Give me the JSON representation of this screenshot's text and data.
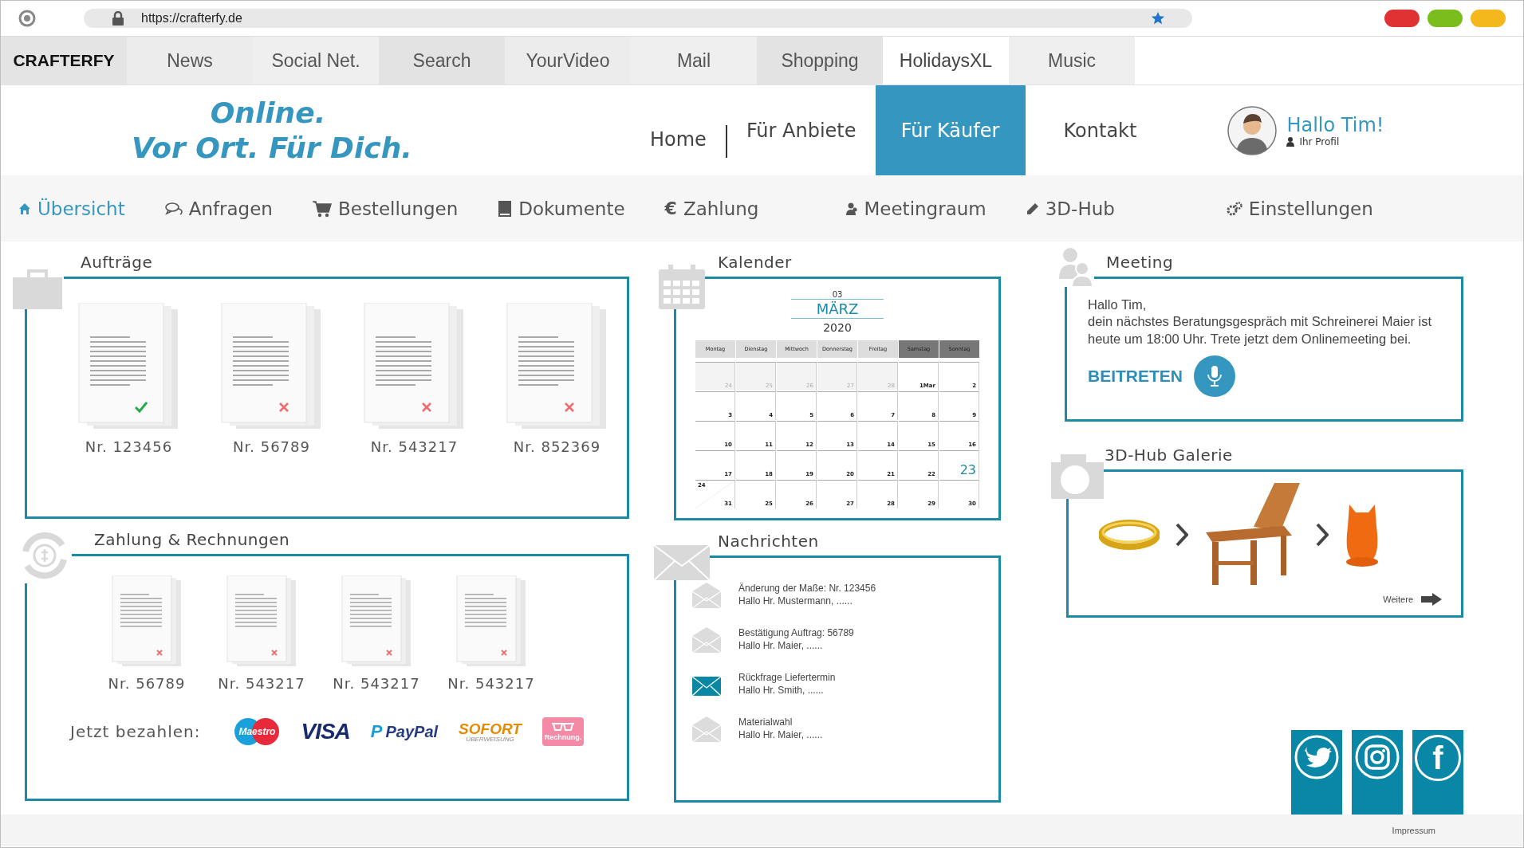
{
  "browser": {
    "url": "https://crafterfy.de",
    "window_buttons": [
      {
        "color": "#e03232"
      },
      {
        "color": "#7cbd1e"
      },
      {
        "color": "#f5b81c"
      }
    ]
  },
  "bookmarks": {
    "brand": "CRAFTERFY",
    "tabs": [
      {
        "label": "News",
        "selected": false
      },
      {
        "label": "Social Net.",
        "selected": false
      },
      {
        "label": "Search",
        "selected": false
      },
      {
        "label": "YourVideo",
        "selected": false
      },
      {
        "label": "Mail",
        "selected": false
      },
      {
        "label": "Shopping",
        "selected": false
      },
      {
        "label": "HolidaysXL",
        "selected": true
      },
      {
        "label": "Music",
        "selected": false
      }
    ]
  },
  "header": {
    "slogan": [
      "Online.",
      "Vor Ort. Für Dich."
    ],
    "nav": [
      {
        "label": "Home",
        "selected": false
      },
      {
        "label": "Für Anbiete",
        "selected": false
      },
      {
        "label": "Für Käufer",
        "selected": true
      },
      {
        "label": "Kontakt",
        "selected": false
      }
    ],
    "greeting": "Hallo Tim!",
    "profile": "Ihr Profil"
  },
  "subnav": [
    {
      "label": "Übersicht",
      "kind": "home",
      "selected": true
    },
    {
      "label": "Anfragen",
      "kind": "chat",
      "selected": false
    },
    {
      "label": "Bestellungen",
      "kind": "cart",
      "selected": false
    },
    {
      "label": "Dokumente",
      "kind": "book",
      "selected": false
    },
    {
      "label": "Zahlung",
      "kind": "euro",
      "icon_text": "€",
      "selected": false
    },
    {
      "label": "Meetingraum",
      "kind": "person",
      "selected": false
    },
    {
      "label": "3D-Hub",
      "kind": "pencil",
      "selected": false
    },
    {
      "label": "Einstellungen",
      "kind": "gears",
      "selected": false
    }
  ],
  "orders": {
    "title": "Aufträge",
    "items": [
      {
        "number": "Nr. 123456",
        "accepted": true
      },
      {
        "number": "Nr. 56789",
        "accepted": false
      },
      {
        "number": "Nr. 543217",
        "accepted": false
      },
      {
        "number": "Nr. 852369",
        "accepted": false
      }
    ]
  },
  "payments": {
    "title": "Zahlung & Rechnungen",
    "items": [
      {
        "number": "Nr. 56789",
        "accepted": false
      },
      {
        "number": "Nr. 543217",
        "accepted": false
      },
      {
        "number": "Nr. 543217",
        "accepted": false
      },
      {
        "number": "Nr. 543217",
        "accepted": false
      }
    ],
    "pay_label": "Jetzt bezahlen:",
    "methods": [
      {
        "kind": "maestro",
        "label": "Maestro"
      },
      {
        "kind": "visa",
        "label": "VISA"
      },
      {
        "kind": "paypal",
        "icon_text": "P",
        "label": "PayPal"
      },
      {
        "kind": "sofort",
        "label": "SOFORT",
        "sub": "ÜBERWEISUNG"
      },
      {
        "kind": "invoice",
        "label": "Rechnung."
      }
    ]
  },
  "calendar": {
    "title": "Kalender",
    "month_number": "03",
    "month": "MÄRZ",
    "year": "2020",
    "weekdays": [
      {
        "label": "Montag",
        "weekend": false
      },
      {
        "label": "Dienstag",
        "weekend": false
      },
      {
        "label": "Mittwoch",
        "weekend": false
      },
      {
        "label": "Donnerstag",
        "weekend": false
      },
      {
        "label": "Freitag",
        "weekend": false
      },
      {
        "label": "Samstag",
        "weekend": true
      },
      {
        "label": "Sonntag",
        "weekend": true
      }
    ],
    "weeks": [
      [
        {
          "label": "24",
          "kind": "other"
        },
        {
          "label": "25",
          "kind": "other"
        },
        {
          "label": "26",
          "kind": "other"
        },
        {
          "label": "27",
          "kind": "other"
        },
        {
          "label": "28",
          "kind": "other"
        },
        {
          "label": "1Mar",
          "kind": "day"
        },
        {
          "label": "2",
          "kind": "day"
        }
      ],
      [
        {
          "label": "3",
          "kind": "day"
        },
        {
          "label": "4",
          "kind": "day"
        },
        {
          "label": "5",
          "kind": "day"
        },
        {
          "label": "6",
          "kind": "day"
        },
        {
          "label": "7",
          "kind": "day"
        },
        {
          "label": "8",
          "kind": "day"
        },
        {
          "label": "9",
          "kind": "day"
        }
      ],
      [
        {
          "label": "10",
          "kind": "day"
        },
        {
          "label": "11",
          "kind": "day"
        },
        {
          "label": "12",
          "kind": "day"
        },
        {
          "label": "13",
          "kind": "day"
        },
        {
          "label": "14",
          "kind": "day"
        },
        {
          "label": "15",
          "kind": "day"
        },
        {
          "label": "16",
          "kind": "day"
        }
      ],
      [
        {
          "label": "17",
          "kind": "day"
        },
        {
          "label": "18",
          "kind": "day"
        },
        {
          "label": "19",
          "kind": "day"
        },
        {
          "label": "20",
          "kind": "day"
        },
        {
          "label": "21",
          "kind": "day"
        },
        {
          "label": "22",
          "kind": "day"
        },
        {
          "label": "23",
          "kind": "today"
        }
      ],
      [
        {
          "label": "31",
          "kind": "split",
          "upper": "24"
        },
        {
          "label": "25",
          "kind": "day"
        },
        {
          "label": "26",
          "kind": "day"
        },
        {
          "label": "27",
          "kind": "day"
        },
        {
          "label": "28",
          "kind": "day"
        },
        {
          "label": "29",
          "kind": "day"
        },
        {
          "label": "30",
          "kind": "day"
        }
      ]
    ]
  },
  "messages": {
    "title": "Nachrichten",
    "items": [
      {
        "subject": "Änderung der Maße: Nr. 123456",
        "preview": "Hallo Hr. Mustermann, ......",
        "unread": false
      },
      {
        "subject": "Bestätigung Auftrag: 56789",
        "preview": "Hallo Hr. Maier, ......",
        "unread": false
      },
      {
        "subject": "Rückfrage Liefertermin",
        "preview": "Hallo Hr. Smith, ......",
        "unread": true
      },
      {
        "subject": "Materialwahl",
        "preview": "Hallo Hr. Maier, ......",
        "unread": false
      }
    ]
  },
  "meeting": {
    "title": "Meeting",
    "greeting": "Hallo Tim,",
    "text": "dein nächstes Beratungsgespräch mit Schreinerei Maier ist heute um 18:00 Uhr. Trete jetzt dem Onlinemeeting bei.",
    "join": "BEITRETEN"
  },
  "gallery": {
    "title": "3D-Hub Galerie",
    "items": [
      {
        "kind": "ring"
      },
      {
        "kind": "chair"
      },
      {
        "kind": "owl"
      }
    ],
    "more": "Weitere"
  },
  "social": [
    {
      "kind": "bird"
    },
    {
      "kind": "camera"
    },
    {
      "kind": "letter",
      "text": "f"
    }
  ],
  "footer": {
    "link": "Impressum"
  }
}
